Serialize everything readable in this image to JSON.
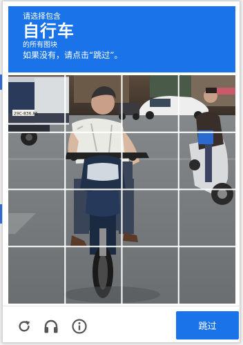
{
  "header": {
    "line1": "请选择包含",
    "target": "自行车",
    "line3": "的所有图块",
    "line4": "如果没有，请点击“跳过”。"
  },
  "grid": {
    "rows": 4,
    "cols": 4
  },
  "image": {
    "plate_text": "29C-836.85"
  },
  "footer": {
    "reload_icon": "reload-icon",
    "audio_icon": "headphones-icon",
    "info_icon": "info-icon",
    "skip_label": "跳过"
  },
  "colors": {
    "accent": "#1a73e8",
    "grid_line": "#ffffff",
    "icon": "#555555"
  }
}
